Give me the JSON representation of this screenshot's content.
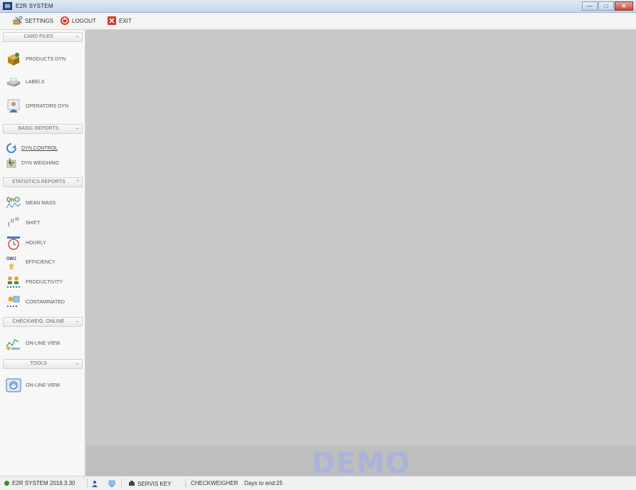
{
  "window": {
    "title": "E2R SYSTEM",
    "controls": {
      "minimize": "—",
      "maximize": "□",
      "close": "✕"
    }
  },
  "toolbar": {
    "settings_label": "SETTINGS",
    "logout_label": "LOGOUT",
    "exit_label": "EXIT"
  },
  "sidebar": {
    "sections": {
      "card_files": {
        "header": "CARD FILES",
        "items": [
          {
            "label": "PRODUCTS DYN",
            "icon": "box-icon"
          },
          {
            "label": "LABELS",
            "icon": "printer-icon"
          },
          {
            "label": "OPERATORS DYN",
            "icon": "operator-icon"
          }
        ]
      },
      "basic_reports": {
        "header": "BASIC REPORTS",
        "items": [
          {
            "label": "DYN CONTROL",
            "icon": "control-icon"
          },
          {
            "label": "DYN WEIGHING",
            "icon": "weighing-icon"
          }
        ]
      },
      "statistics_reports": {
        "header": "STATISTICS REPORTS",
        "items": [
          {
            "label": "MEAN MASS",
            "icon": "mean-mass-icon",
            "icon_text": "Qn"
          },
          {
            "label": "SHIFT",
            "icon": "shift-icon"
          },
          {
            "label": "HOURLY",
            "icon": "clock-icon"
          },
          {
            "label": "EFFICIENCY",
            "icon": "efficiency-icon",
            "icon_text": "OWJ"
          },
          {
            "label": "PRODUCTIVITY",
            "icon": "productivity-icon"
          },
          {
            "label": "CONTAMINATED",
            "icon": "contaminated-icon"
          }
        ]
      },
      "checkweig_online": {
        "header": "CHECKWEIG. ONLINE",
        "items": [
          {
            "label": "ON-LINE VIEW",
            "icon": "online-chart-icon"
          }
        ]
      },
      "tools": {
        "header": "TOOLS",
        "items": [
          {
            "label": "ON-LINE VIEW",
            "icon": "online-view-icon"
          }
        ]
      }
    }
  },
  "main": {
    "watermark": "DEMO"
  },
  "statusbar": {
    "version": "E2R SYSTEM 2016.3.30",
    "servis_key": "SERVIS KEY",
    "device": "CHECKWEIGHER",
    "days_to_end": "Days to end:25"
  },
  "colors": {
    "main_bg": "#c8c8c8",
    "demo_text": "#aab3dc",
    "close_button": "#c74a3a",
    "sidebar_bg": "#f7f7f7"
  }
}
